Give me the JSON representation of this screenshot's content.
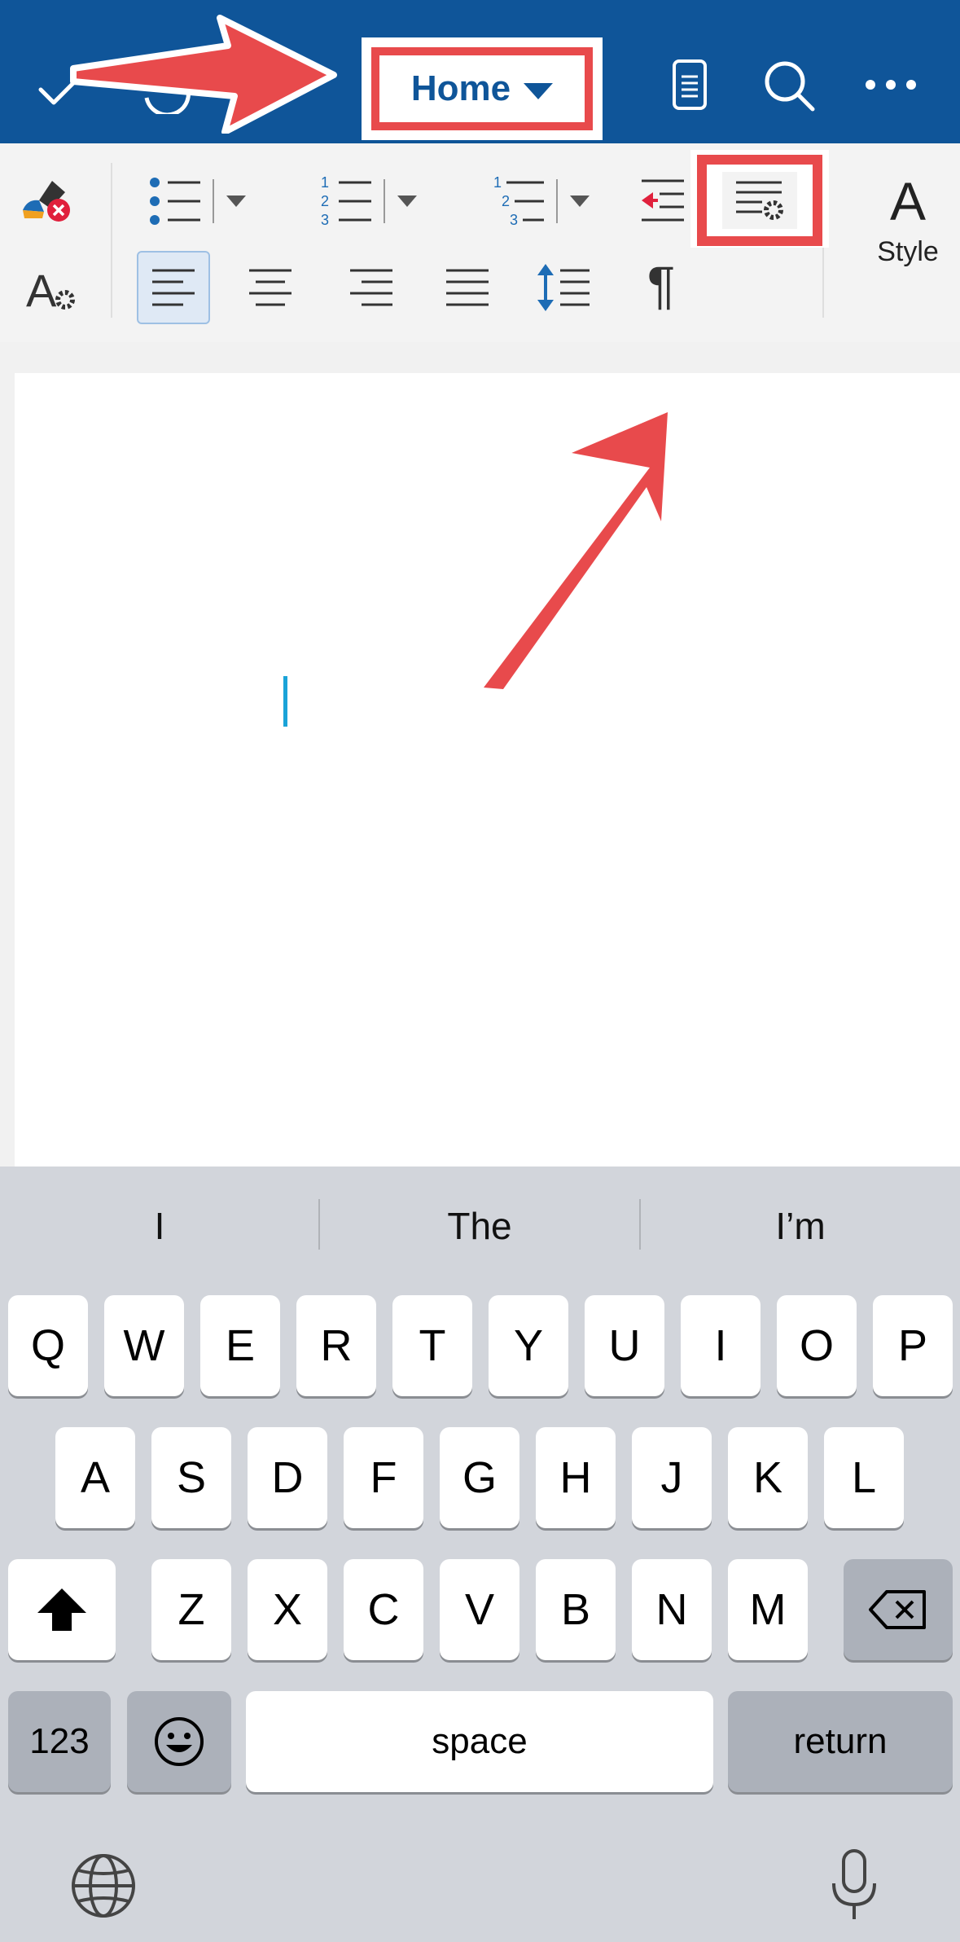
{
  "topbar": {
    "tab_label": "Home",
    "icons": [
      "checkmark-icon",
      "undo-icon",
      "mobile-view-icon",
      "search-icon",
      "more-icon"
    ]
  },
  "ribbon": {
    "style_label": "Style",
    "row1_icons": [
      "clear-formatting-icon",
      "bullet-list-icon",
      "numbered-list-icon",
      "multilevel-list-icon",
      "decrease-indent-icon",
      "increase-indent-icon"
    ],
    "row2_icons": [
      "font-settings-icon",
      "align-left-icon",
      "align-center-icon",
      "align-right-icon",
      "justify-icon",
      "line-spacing-icon",
      "paragraph-marks-icon",
      "paragraph-settings-icon"
    ],
    "active_alignment": "align-left"
  },
  "keyboard": {
    "predictions": [
      "I",
      "The",
      "I’m"
    ],
    "row1": [
      "Q",
      "W",
      "E",
      "R",
      "T",
      "Y",
      "U",
      "I",
      "O",
      "P"
    ],
    "row2": [
      "A",
      "S",
      "D",
      "F",
      "G",
      "H",
      "J",
      "K",
      "L"
    ],
    "row3": [
      "Z",
      "X",
      "C",
      "V",
      "B",
      "N",
      "M"
    ],
    "numbers_label": "123",
    "space_label": "space",
    "return_label": "return"
  },
  "colors": {
    "topbar": "#0f5599",
    "accent_blue": "#1d6cb5",
    "annotation_red": "#e84a4c",
    "cursor": "#1aa3d8",
    "keyboard_bg": "#d2d5db"
  }
}
